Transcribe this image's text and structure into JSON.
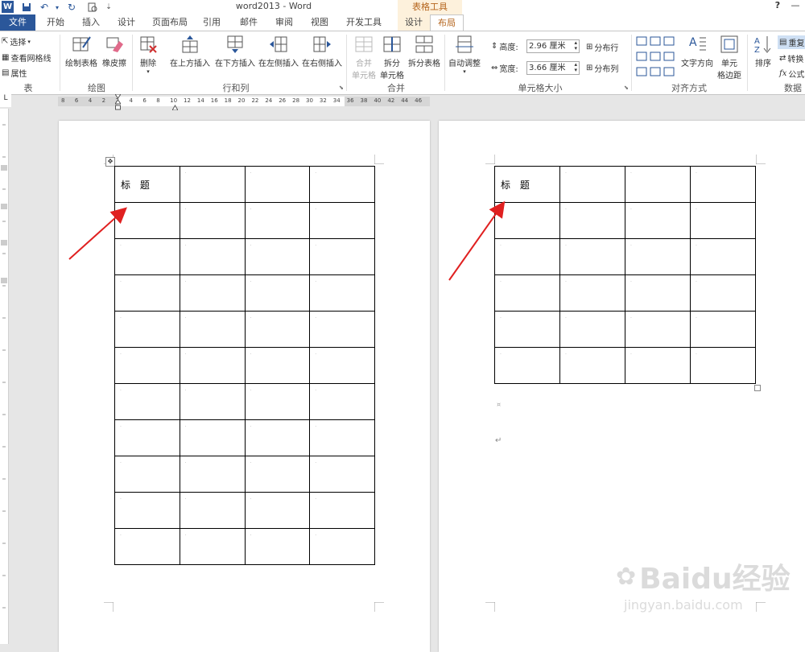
{
  "title_bar": {
    "document_title": "word2013 - Word",
    "context_group": "表格工具",
    "help": "?",
    "minimize": "—"
  },
  "tabs": [
    "文件",
    "开始",
    "插入",
    "设计",
    "页面布局",
    "引用",
    "邮件",
    "审阅",
    "视图",
    "开发工具",
    "设计",
    "布局"
  ],
  "ribbon": {
    "table_group": {
      "label": "表",
      "items": [
        "选择",
        "查看网格线",
        "属性"
      ]
    },
    "draw_group": {
      "label": "绘图",
      "items": [
        "绘制表格",
        "橡皮擦"
      ]
    },
    "rows_cols_group": {
      "label": "行和列",
      "items": [
        "删除",
        "在上方插入",
        "在下方插入",
        "在左侧插入",
        "在右侧插入"
      ]
    },
    "merge_group": {
      "label": "合并",
      "merge_cells_l1": "合并",
      "merge_cells_l2": "单元格",
      "split_cells_l1": "拆分",
      "split_cells_l2": "单元格",
      "split_table": "拆分表格"
    },
    "cell_size_group": {
      "label": "单元格大小",
      "autofit": "自动调整",
      "height_label": "高度:",
      "height_value": "2.96 厘米",
      "width_label": "宽度:",
      "width_value": "3.66 厘米",
      "distribute_rows": "分布行",
      "distribute_cols": "分布列"
    },
    "alignment_group": {
      "label": "对齐方式",
      "text_direction": "文字方向",
      "cell_margins_l1": "单元",
      "cell_margins_l2": "格边距"
    },
    "data_group": {
      "label": "数据",
      "sort": "排序",
      "repeat_header": "重复",
      "convert": "转换",
      "formula": "公式"
    }
  },
  "ruler": {
    "corner": "L",
    "numbers": [
      "8",
      "6",
      "4",
      "2",
      "2",
      "4",
      "6",
      "8",
      "10",
      "12",
      "14",
      "16",
      "18",
      "20",
      "22",
      "24",
      "26",
      "28",
      "30",
      "32",
      "34",
      "36",
      "38",
      "40",
      "42",
      "44",
      "46"
    ]
  },
  "document": {
    "left_table": {
      "title_cell": "标 题",
      "rows": 11,
      "cols": 4
    },
    "right_table": {
      "title_cell": "标 题",
      "rows": 6,
      "cols": 4
    },
    "cell_mark": "¤",
    "paragraph_mark": "↵"
  },
  "watermark": {
    "brand": "Baidu经验",
    "url": "jingyan.baidu.com"
  },
  "colors": {
    "word_blue": "#2b579a",
    "context_orange": "#b5651d",
    "arrow_red": "#e02020"
  }
}
